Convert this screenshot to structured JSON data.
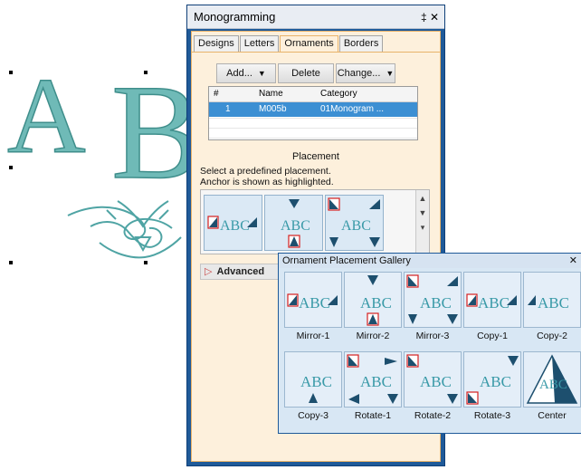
{
  "canvas": {
    "monogram_letters": [
      "A",
      "B"
    ],
    "thread_color": "#6fbab7",
    "ornament_color": "#4fa4a4"
  },
  "panel": {
    "title": "Monogramming",
    "title_icons": "‡ ✕",
    "tabs": [
      {
        "label": "Designs",
        "active": false
      },
      {
        "label": "Letters",
        "active": false
      },
      {
        "label": "Ornaments",
        "active": true
      },
      {
        "label": "Borders",
        "active": false
      }
    ],
    "toolbar": {
      "add_label": "Add...",
      "delete_label": "Delete",
      "change_label": "Change..."
    },
    "grid": {
      "columns": [
        "#",
        "Name",
        "Category"
      ],
      "rows": [
        {
          "num": "1",
          "name": "M005b",
          "category": "01Monogram ..."
        }
      ]
    },
    "placement_label": "Placement",
    "hint_line1": "Select a predefined placement.",
    "hint_line2": "Anchor is shown as highlighted.",
    "advanced_label": "Advanced",
    "accent": "#e8b36a",
    "window_color": "#1f5a99"
  },
  "gallery": {
    "title": "Ornament Placement Gallery",
    "close": "✕",
    "items": [
      {
        "label": "Mirror-1"
      },
      {
        "label": "Mirror-2"
      },
      {
        "label": "Mirror-3"
      },
      {
        "label": "Copy-1"
      },
      {
        "label": "Copy-2"
      },
      {
        "label": "Copy-3"
      },
      {
        "label": "Rotate-1"
      },
      {
        "label": "Rotate-2"
      },
      {
        "label": "Rotate-3"
      },
      {
        "label": "Center"
      }
    ],
    "tile_text": "ABC",
    "monogram_color": "#3a9aa8",
    "anchor_color": "#d42020"
  }
}
